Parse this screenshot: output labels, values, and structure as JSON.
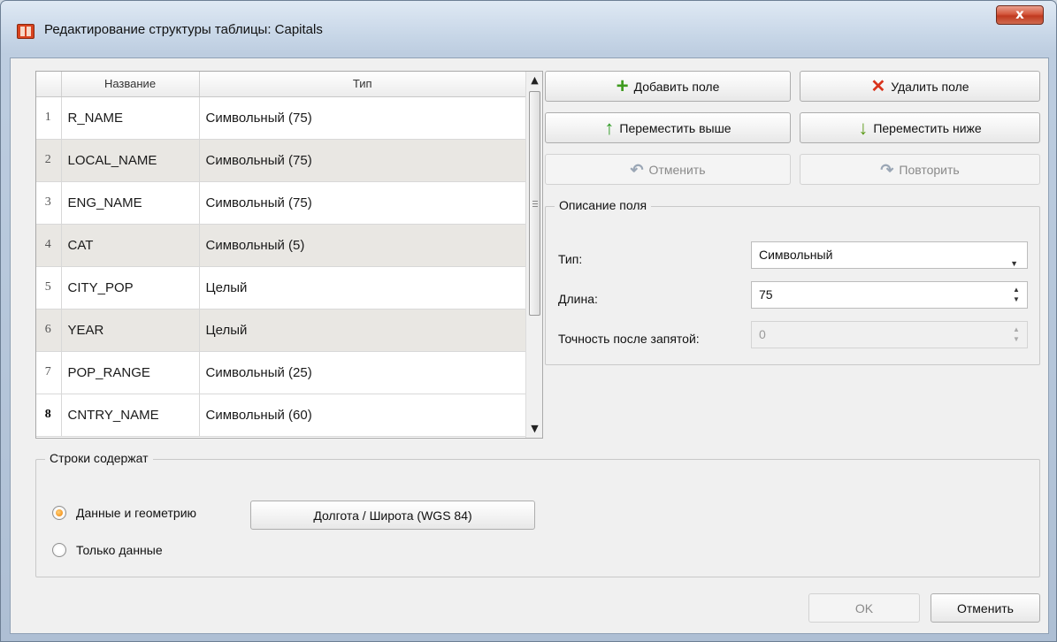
{
  "window": {
    "title": "Редактирование структуры таблицы: Capitals",
    "close_label": "x",
    "icon": "map-book-icon"
  },
  "grid": {
    "columns": [
      "Название",
      "Тип"
    ],
    "rows": [
      {
        "num": "1",
        "name": "R_NAME",
        "type": "Символьный (75)"
      },
      {
        "num": "2",
        "name": "LOCAL_NAME",
        "type": "Символьный (75)"
      },
      {
        "num": "3",
        "name": "ENG_NAME",
        "type": "Символьный (75)"
      },
      {
        "num": "4",
        "name": "CAT",
        "type": "Символьный (5)"
      },
      {
        "num": "5",
        "name": "CITY_POP",
        "type": "Целый"
      },
      {
        "num": "6",
        "name": "YEAR",
        "type": "Целый"
      },
      {
        "num": "7",
        "name": "POP_RANGE",
        "type": "Символьный (25)"
      },
      {
        "num": "8",
        "name": "CNTRY_NAME",
        "type": "Символьный (60)"
      }
    ],
    "selected_row": "8"
  },
  "buttons": {
    "add_field": "Добавить поле",
    "delete_field": "Удалить поле",
    "move_up": "Переместить выше",
    "move_down": "Переместить ниже",
    "undo": "Отменить",
    "redo": "Повторить"
  },
  "field_description": {
    "title": "Описание поля",
    "type_label": "Тип:",
    "type_value": "Символьный",
    "length_label": "Длина:",
    "length_value": "75",
    "precision_label": "Точность после запятой:",
    "precision_value": "0"
  },
  "rows_contain": {
    "title": "Строки содержат",
    "option_geometry": "Данные и геометрию",
    "option_data_only": "Только данные",
    "selected": "option_geometry",
    "crs_button": "Долгота / Широта (WGS 84)"
  },
  "footer": {
    "ok": "OK",
    "cancel": "Отменить"
  },
  "colors": {
    "accent_green": "#3e9b1e",
    "accent_red": "#d9331c",
    "radio_orange": "#f07d00"
  }
}
